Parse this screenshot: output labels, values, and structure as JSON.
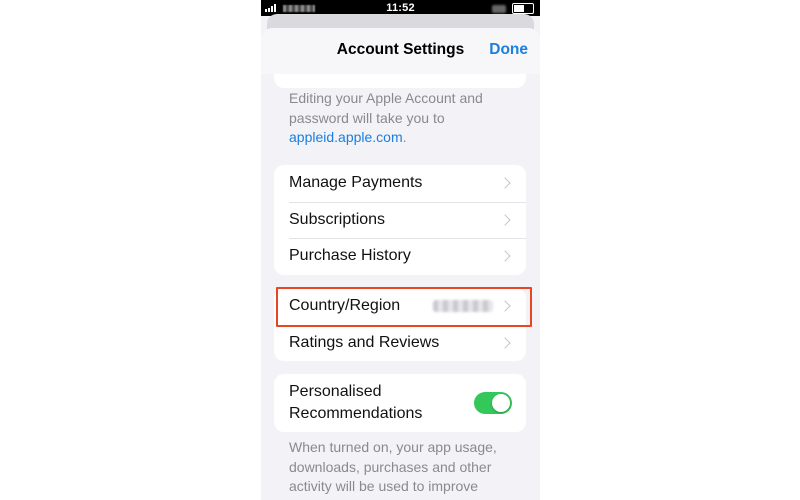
{
  "status_bar": {
    "time": "11:52"
  },
  "nav": {
    "title": "Account Settings",
    "done_label": "Done"
  },
  "apple_account": {
    "note_text": "Editing your Apple Account and password will take you to ",
    "link_text": "appleid.apple.com",
    "note_suffix": "."
  },
  "payments_group": {
    "items": [
      {
        "label": "Manage Payments"
      },
      {
        "label": "Subscriptions"
      },
      {
        "label": "Purchase History"
      }
    ]
  },
  "region_group": {
    "items": [
      {
        "label": "Country/Region"
      },
      {
        "label": "Ratings and Reviews"
      }
    ]
  },
  "recommendations": {
    "label": "Personalised Recommendations",
    "enabled": true,
    "description": "When turned on, your app usage, downloads, purchases and other activity will be used to improve"
  },
  "colors": {
    "accent": "#1a7fe0",
    "toggle_on": "#34c759",
    "highlight": "#e84522"
  }
}
